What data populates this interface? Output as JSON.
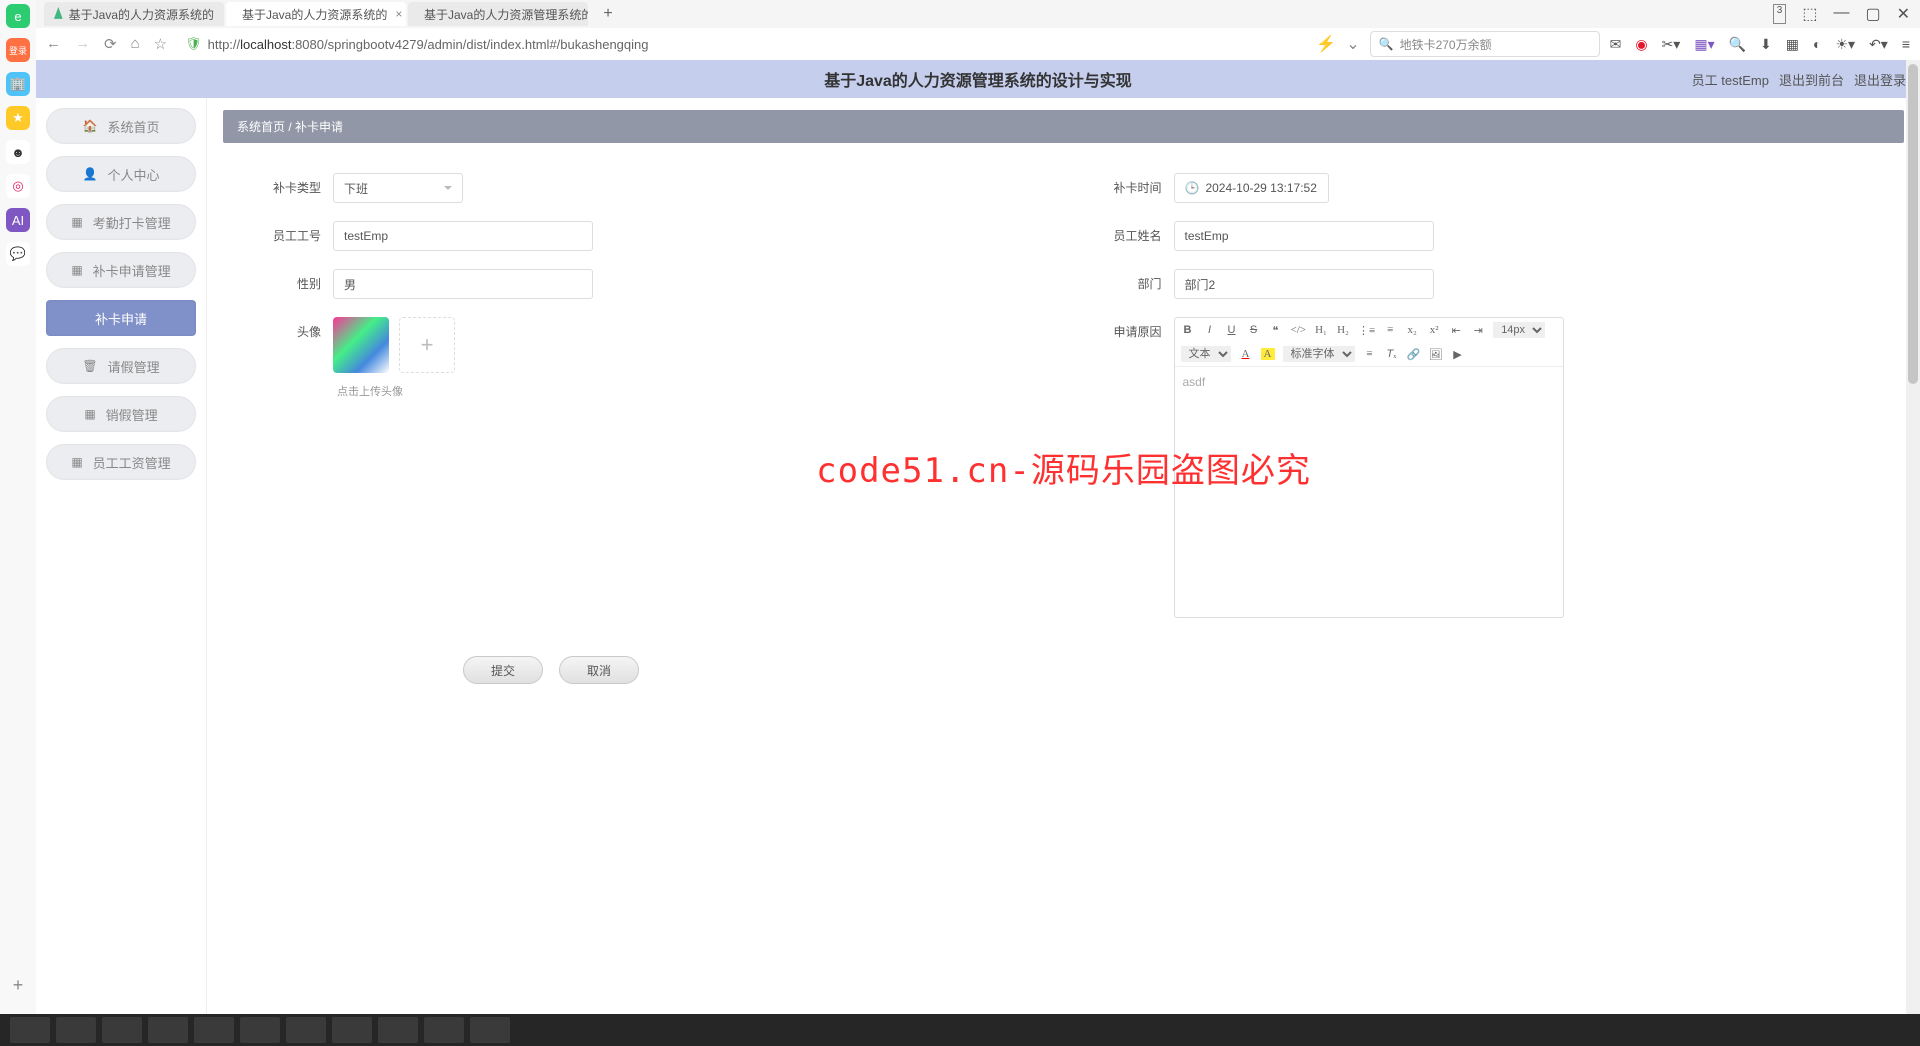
{
  "browser": {
    "tabs": [
      {
        "title": "基于Java的人力资源系统的"
      },
      {
        "title": "基于Java的人力资源系统的"
      },
      {
        "title": "基于Java的人力资源管理系统的"
      }
    ],
    "tab_count_badge": "3",
    "url_prefix": "http://",
    "url_host": "localhost",
    "url_rest": ":8080/springbootv4279/admin/dist/index.html#/bukashengqing",
    "search_placeholder": "地铁卡270万余额"
  },
  "app": {
    "title": "基于Java的人力资源管理系统的设计与实现",
    "user_label": "员工 testEmp",
    "logout_front": "退出到前台",
    "logout": "退出登录"
  },
  "sidebar": {
    "items": [
      {
        "label": "系统首页",
        "icon": "🏠"
      },
      {
        "label": "个人中心",
        "icon": "👤"
      },
      {
        "label": "考勤打卡管理",
        "icon": "▦"
      },
      {
        "label": "补卡申请管理",
        "icon": "▦"
      },
      {
        "label": "补卡申请",
        "icon": ""
      },
      {
        "label": "请假管理",
        "icon": "🗑"
      },
      {
        "label": "销假管理",
        "icon": "▦"
      },
      {
        "label": "员工工资管理",
        "icon": "▦"
      }
    ]
  },
  "breadcrumb": {
    "home": "系统首页",
    "current": "补卡申请"
  },
  "form": {
    "type_label": "补卡类型",
    "type_value": "下班",
    "time_label": "补卡时间",
    "time_value": "2024-10-29 13:17:52",
    "empno_label": "员工工号",
    "empno_value": "testEmp",
    "empname_label": "员工姓名",
    "empname_value": "testEmp",
    "gender_label": "性别",
    "gender_value": "男",
    "dept_label": "部门",
    "dept_value": "部门2",
    "avatar_label": "头像",
    "upload_hint": "点击上传头像",
    "reason_label": "申请原因",
    "reason_placeholder": "asdf",
    "editor_fontsize": "14px",
    "editor_texttype": "文本",
    "editor_font": "标准字体",
    "submit": "提交",
    "cancel": "取消"
  },
  "watermark": "code51.cn-源码乐园盗图必究"
}
